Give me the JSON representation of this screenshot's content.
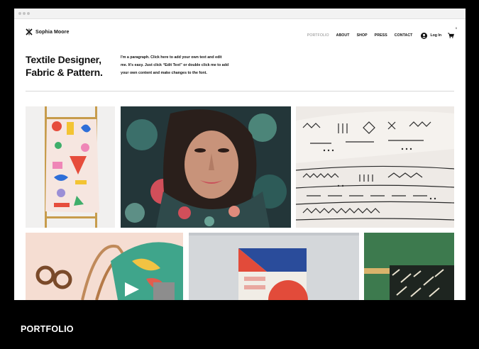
{
  "site": {
    "name": "Sophia Moore",
    "nav": [
      {
        "label": "PORTFOLIO",
        "active": true
      },
      {
        "label": "ABOUT",
        "active": false
      },
      {
        "label": "SHOP",
        "active": false
      },
      {
        "label": "PRESS",
        "active": false
      },
      {
        "label": "CONTACT",
        "active": false
      }
    ],
    "login_label": "Log In",
    "cart_count": "0"
  },
  "hero": {
    "title_line1": "Textile Designer,",
    "title_line2": "Fabric & Pattern.",
    "paragraph_lines": [
      "I'm a paragraph. Click here to add your own text and edit",
      "me. It's easy. Just click “Edit Text” or double click me to add",
      "your own content and make changes to the font."
    ]
  },
  "gallery": {
    "images": [
      {
        "subject": "patterned scarf on wooden ladder"
      },
      {
        "subject": "woman wrapped in floral scarf"
      },
      {
        "subject": "stack of mudcloth patterned fabric"
      },
      {
        "subject": "leather tote bag with sunglasses"
      },
      {
        "subject": "geometric print fabric hanging"
      },
      {
        "subject": "striped fabric on green background"
      }
    ]
  },
  "caption": "PORTFOLIO",
  "colors": {
    "background": "#000000",
    "page": "#ffffff",
    "text": "#111111",
    "nav_active": "#8b8b8b"
  }
}
